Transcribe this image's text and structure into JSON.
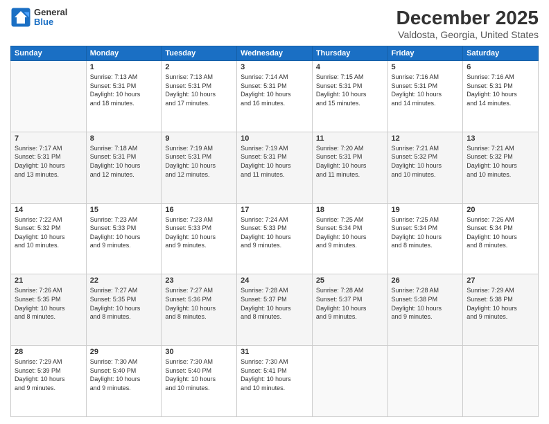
{
  "logo": {
    "general": "General",
    "blue": "Blue"
  },
  "title": "December 2025",
  "subtitle": "Valdosta, Georgia, United States",
  "days_of_week": [
    "Sunday",
    "Monday",
    "Tuesday",
    "Wednesday",
    "Thursday",
    "Friday",
    "Saturday"
  ],
  "weeks": [
    [
      {
        "day": "",
        "info": ""
      },
      {
        "day": "1",
        "info": "Sunrise: 7:13 AM\nSunset: 5:31 PM\nDaylight: 10 hours\nand 18 minutes."
      },
      {
        "day": "2",
        "info": "Sunrise: 7:13 AM\nSunset: 5:31 PM\nDaylight: 10 hours\nand 17 minutes."
      },
      {
        "day": "3",
        "info": "Sunrise: 7:14 AM\nSunset: 5:31 PM\nDaylight: 10 hours\nand 16 minutes."
      },
      {
        "day": "4",
        "info": "Sunrise: 7:15 AM\nSunset: 5:31 PM\nDaylight: 10 hours\nand 15 minutes."
      },
      {
        "day": "5",
        "info": "Sunrise: 7:16 AM\nSunset: 5:31 PM\nDaylight: 10 hours\nand 14 minutes."
      },
      {
        "day": "6",
        "info": "Sunrise: 7:16 AM\nSunset: 5:31 PM\nDaylight: 10 hours\nand 14 minutes."
      }
    ],
    [
      {
        "day": "7",
        "info": "Sunrise: 7:17 AM\nSunset: 5:31 PM\nDaylight: 10 hours\nand 13 minutes."
      },
      {
        "day": "8",
        "info": "Sunrise: 7:18 AM\nSunset: 5:31 PM\nDaylight: 10 hours\nand 12 minutes."
      },
      {
        "day": "9",
        "info": "Sunrise: 7:19 AM\nSunset: 5:31 PM\nDaylight: 10 hours\nand 12 minutes."
      },
      {
        "day": "10",
        "info": "Sunrise: 7:19 AM\nSunset: 5:31 PM\nDaylight: 10 hours\nand 11 minutes."
      },
      {
        "day": "11",
        "info": "Sunrise: 7:20 AM\nSunset: 5:31 PM\nDaylight: 10 hours\nand 11 minutes."
      },
      {
        "day": "12",
        "info": "Sunrise: 7:21 AM\nSunset: 5:32 PM\nDaylight: 10 hours\nand 10 minutes."
      },
      {
        "day": "13",
        "info": "Sunrise: 7:21 AM\nSunset: 5:32 PM\nDaylight: 10 hours\nand 10 minutes."
      }
    ],
    [
      {
        "day": "14",
        "info": "Sunrise: 7:22 AM\nSunset: 5:32 PM\nDaylight: 10 hours\nand 10 minutes."
      },
      {
        "day": "15",
        "info": "Sunrise: 7:23 AM\nSunset: 5:33 PM\nDaylight: 10 hours\nand 9 minutes."
      },
      {
        "day": "16",
        "info": "Sunrise: 7:23 AM\nSunset: 5:33 PM\nDaylight: 10 hours\nand 9 minutes."
      },
      {
        "day": "17",
        "info": "Sunrise: 7:24 AM\nSunset: 5:33 PM\nDaylight: 10 hours\nand 9 minutes."
      },
      {
        "day": "18",
        "info": "Sunrise: 7:25 AM\nSunset: 5:34 PM\nDaylight: 10 hours\nand 9 minutes."
      },
      {
        "day": "19",
        "info": "Sunrise: 7:25 AM\nSunset: 5:34 PM\nDaylight: 10 hours\nand 8 minutes."
      },
      {
        "day": "20",
        "info": "Sunrise: 7:26 AM\nSunset: 5:34 PM\nDaylight: 10 hours\nand 8 minutes."
      }
    ],
    [
      {
        "day": "21",
        "info": "Sunrise: 7:26 AM\nSunset: 5:35 PM\nDaylight: 10 hours\nand 8 minutes."
      },
      {
        "day": "22",
        "info": "Sunrise: 7:27 AM\nSunset: 5:35 PM\nDaylight: 10 hours\nand 8 minutes."
      },
      {
        "day": "23",
        "info": "Sunrise: 7:27 AM\nSunset: 5:36 PM\nDaylight: 10 hours\nand 8 minutes."
      },
      {
        "day": "24",
        "info": "Sunrise: 7:28 AM\nSunset: 5:37 PM\nDaylight: 10 hours\nand 8 minutes."
      },
      {
        "day": "25",
        "info": "Sunrise: 7:28 AM\nSunset: 5:37 PM\nDaylight: 10 hours\nand 9 minutes."
      },
      {
        "day": "26",
        "info": "Sunrise: 7:28 AM\nSunset: 5:38 PM\nDaylight: 10 hours\nand 9 minutes."
      },
      {
        "day": "27",
        "info": "Sunrise: 7:29 AM\nSunset: 5:38 PM\nDaylight: 10 hours\nand 9 minutes."
      }
    ],
    [
      {
        "day": "28",
        "info": "Sunrise: 7:29 AM\nSunset: 5:39 PM\nDaylight: 10 hours\nand 9 minutes."
      },
      {
        "day": "29",
        "info": "Sunrise: 7:30 AM\nSunset: 5:40 PM\nDaylight: 10 hours\nand 9 minutes."
      },
      {
        "day": "30",
        "info": "Sunrise: 7:30 AM\nSunset: 5:40 PM\nDaylight: 10 hours\nand 10 minutes."
      },
      {
        "day": "31",
        "info": "Sunrise: 7:30 AM\nSunset: 5:41 PM\nDaylight: 10 hours\nand 10 minutes."
      },
      {
        "day": "",
        "info": ""
      },
      {
        "day": "",
        "info": ""
      },
      {
        "day": "",
        "info": ""
      }
    ]
  ]
}
